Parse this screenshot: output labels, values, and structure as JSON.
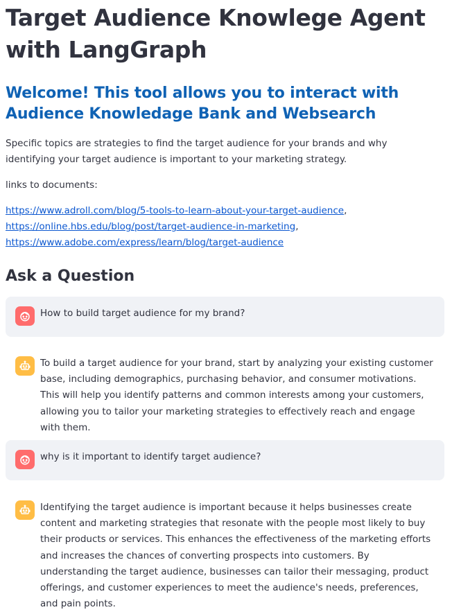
{
  "header": {
    "title": "Target Audience Knowlege Agent with LangGraph",
    "welcome": "Welcome! This tool allows you to interact with Audience Knowledage Bank and Websearch"
  },
  "intro": {
    "description": "Specific topics are strategies to find the target audience for your brands and why identifying your target audience is important to your marketing strategy.",
    "links_label": "links to documents:",
    "links": [
      "https://www.adroll.com/blog/5-tools-to-learn-about-your-target-audience",
      "https://online.hbs.edu/blog/post/target-audience-in-marketing",
      "https://www.adobe.com/express/learn/blog/target-audience"
    ]
  },
  "chat": {
    "section_title": "Ask a Question",
    "messages": [
      {
        "role": "user",
        "text": "How to build target audience for my brand?"
      },
      {
        "role": "assistant",
        "text": "To build a target audience for your brand, start by analyzing your existing customer base, including demographics, purchasing behavior, and consumer motivations. This will help you identify patterns and common interests among your customers, allowing you to tailor your marketing strategies to effectively reach and engage with them."
      },
      {
        "role": "user",
        "text": "why is it important to identify target audience?"
      },
      {
        "role": "assistant",
        "text": "Identifying the target audience is important because it helps businesses create content and marketing strategies that resonate with the people most likely to buy their products or services. This enhances the effectiveness of the marketing efforts and increases the chances of converting prospects into customers. By understanding the target audience, businesses can tailor their messaging, product offerings, and customer experiences to meet the audience's needs, preferences, and pain points."
      }
    ]
  },
  "colors": {
    "user_avatar": "#ff6c6c",
    "assistant_avatar": "#ffbd45",
    "welcome_heading": "#0f62b4",
    "link": "#0b57d0",
    "user_bubble": "#f0f2f6"
  },
  "icons": {
    "user": "face-icon",
    "assistant": "robot-icon"
  }
}
